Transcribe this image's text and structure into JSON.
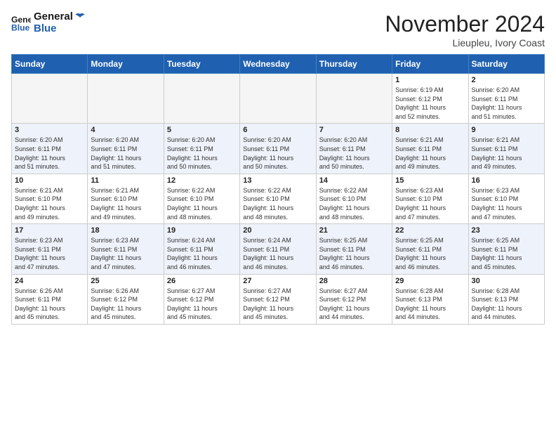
{
  "header": {
    "logo_line1": "General",
    "logo_line2": "Blue",
    "month": "November 2024",
    "location": "Lieupleu, Ivory Coast"
  },
  "weekdays": [
    "Sunday",
    "Monday",
    "Tuesday",
    "Wednesday",
    "Thursday",
    "Friday",
    "Saturday"
  ],
  "weeks": [
    [
      {
        "day": "",
        "info": ""
      },
      {
        "day": "",
        "info": ""
      },
      {
        "day": "",
        "info": ""
      },
      {
        "day": "",
        "info": ""
      },
      {
        "day": "",
        "info": ""
      },
      {
        "day": "1",
        "info": "Sunrise: 6:19 AM\nSunset: 6:12 PM\nDaylight: 11 hours\nand 52 minutes."
      },
      {
        "day": "2",
        "info": "Sunrise: 6:20 AM\nSunset: 6:11 PM\nDaylight: 11 hours\nand 51 minutes."
      }
    ],
    [
      {
        "day": "3",
        "info": "Sunrise: 6:20 AM\nSunset: 6:11 PM\nDaylight: 11 hours\nand 51 minutes."
      },
      {
        "day": "4",
        "info": "Sunrise: 6:20 AM\nSunset: 6:11 PM\nDaylight: 11 hours\nand 51 minutes."
      },
      {
        "day": "5",
        "info": "Sunrise: 6:20 AM\nSunset: 6:11 PM\nDaylight: 11 hours\nand 50 minutes."
      },
      {
        "day": "6",
        "info": "Sunrise: 6:20 AM\nSunset: 6:11 PM\nDaylight: 11 hours\nand 50 minutes."
      },
      {
        "day": "7",
        "info": "Sunrise: 6:20 AM\nSunset: 6:11 PM\nDaylight: 11 hours\nand 50 minutes."
      },
      {
        "day": "8",
        "info": "Sunrise: 6:21 AM\nSunset: 6:11 PM\nDaylight: 11 hours\nand 49 minutes."
      },
      {
        "day": "9",
        "info": "Sunrise: 6:21 AM\nSunset: 6:11 PM\nDaylight: 11 hours\nand 49 minutes."
      }
    ],
    [
      {
        "day": "10",
        "info": "Sunrise: 6:21 AM\nSunset: 6:10 PM\nDaylight: 11 hours\nand 49 minutes."
      },
      {
        "day": "11",
        "info": "Sunrise: 6:21 AM\nSunset: 6:10 PM\nDaylight: 11 hours\nand 49 minutes."
      },
      {
        "day": "12",
        "info": "Sunrise: 6:22 AM\nSunset: 6:10 PM\nDaylight: 11 hours\nand 48 minutes."
      },
      {
        "day": "13",
        "info": "Sunrise: 6:22 AM\nSunset: 6:10 PM\nDaylight: 11 hours\nand 48 minutes."
      },
      {
        "day": "14",
        "info": "Sunrise: 6:22 AM\nSunset: 6:10 PM\nDaylight: 11 hours\nand 48 minutes."
      },
      {
        "day": "15",
        "info": "Sunrise: 6:23 AM\nSunset: 6:10 PM\nDaylight: 11 hours\nand 47 minutes."
      },
      {
        "day": "16",
        "info": "Sunrise: 6:23 AM\nSunset: 6:10 PM\nDaylight: 11 hours\nand 47 minutes."
      }
    ],
    [
      {
        "day": "17",
        "info": "Sunrise: 6:23 AM\nSunset: 6:11 PM\nDaylight: 11 hours\nand 47 minutes."
      },
      {
        "day": "18",
        "info": "Sunrise: 6:23 AM\nSunset: 6:11 PM\nDaylight: 11 hours\nand 47 minutes."
      },
      {
        "day": "19",
        "info": "Sunrise: 6:24 AM\nSunset: 6:11 PM\nDaylight: 11 hours\nand 46 minutes."
      },
      {
        "day": "20",
        "info": "Sunrise: 6:24 AM\nSunset: 6:11 PM\nDaylight: 11 hours\nand 46 minutes."
      },
      {
        "day": "21",
        "info": "Sunrise: 6:25 AM\nSunset: 6:11 PM\nDaylight: 11 hours\nand 46 minutes."
      },
      {
        "day": "22",
        "info": "Sunrise: 6:25 AM\nSunset: 6:11 PM\nDaylight: 11 hours\nand 46 minutes."
      },
      {
        "day": "23",
        "info": "Sunrise: 6:25 AM\nSunset: 6:11 PM\nDaylight: 11 hours\nand 45 minutes."
      }
    ],
    [
      {
        "day": "24",
        "info": "Sunrise: 6:26 AM\nSunset: 6:11 PM\nDaylight: 11 hours\nand 45 minutes."
      },
      {
        "day": "25",
        "info": "Sunrise: 6:26 AM\nSunset: 6:12 PM\nDaylight: 11 hours\nand 45 minutes."
      },
      {
        "day": "26",
        "info": "Sunrise: 6:27 AM\nSunset: 6:12 PM\nDaylight: 11 hours\nand 45 minutes."
      },
      {
        "day": "27",
        "info": "Sunrise: 6:27 AM\nSunset: 6:12 PM\nDaylight: 11 hours\nand 45 minutes."
      },
      {
        "day": "28",
        "info": "Sunrise: 6:27 AM\nSunset: 6:12 PM\nDaylight: 11 hours\nand 44 minutes."
      },
      {
        "day": "29",
        "info": "Sunrise: 6:28 AM\nSunset: 6:13 PM\nDaylight: 11 hours\nand 44 minutes."
      },
      {
        "day": "30",
        "info": "Sunrise: 6:28 AM\nSunset: 6:13 PM\nDaylight: 11 hours\nand 44 minutes."
      }
    ]
  ]
}
